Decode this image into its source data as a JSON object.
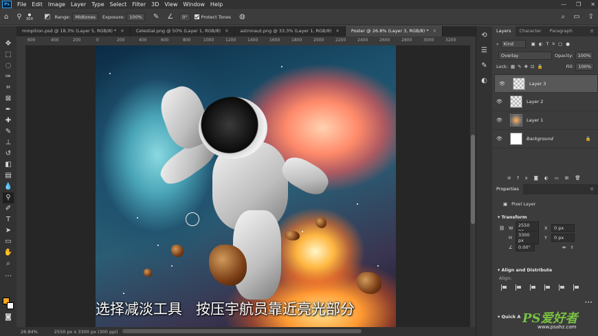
{
  "menubar": {
    "app_icon": "Ps",
    "items": [
      "File",
      "Edit",
      "Image",
      "Layer",
      "Type",
      "Select",
      "Filter",
      "3D",
      "View",
      "Window",
      "Help"
    ]
  },
  "options": {
    "brush_size": "300",
    "range_label": "Range:",
    "range_value": "Midtones",
    "exposure_label": "Exposure:",
    "exposure_value": "100%",
    "angle_value": "0°",
    "protect_tones": "Protect Tones"
  },
  "tabs": [
    {
      "label": "mmpition.psd @ 18.3% (Layer 5, RGB/8) *"
    },
    {
      "label": "Celestial.png @ 50% (Layer 1, RGB/8)"
    },
    {
      "label": "astronaut.png @ 33.3% (Layer 1, RGB/8)"
    },
    {
      "label": "Poster @ 26.8% (Layer 3, RGB/8) *"
    }
  ],
  "ruler": [
    "600",
    "400",
    "200",
    "0",
    "200",
    "400",
    "600",
    "800",
    "1000",
    "1200",
    "1400",
    "1600",
    "1800",
    "2000",
    "2200",
    "2400",
    "2600",
    "2800",
    "3000",
    "3200"
  ],
  "status": {
    "zoom": "26.84%",
    "doc_size": "2550 px x 3300 px (300 ppi)"
  },
  "subtitle": "选择减淡工具   按压宇航员靠近亮光部分",
  "layers_panel": {
    "tabs": [
      "Layers",
      "Character",
      "Paragraph"
    ],
    "kind": "Kind",
    "blend_mode": "Overlay",
    "opacity_label": "Opacity:",
    "opacity": "100%",
    "lock_label": "Lock:",
    "fill_label": "Fill:",
    "fill": "100%",
    "layers": [
      {
        "name": "Layer 3",
        "selected": true
      },
      {
        "name": "Layer 2",
        "selected": false
      },
      {
        "name": "Layer 1",
        "selected": false
      },
      {
        "name": "Background",
        "selected": false
      }
    ]
  },
  "properties": {
    "title": "Properties",
    "type": "Pixel Layer",
    "transform": "Transform",
    "w_label": "W",
    "w": "2550 px",
    "h_label": "H",
    "h": "3300 px",
    "x_label": "X",
    "x": "0 px",
    "y_label": "Y",
    "y": "0 px",
    "angle": "0.00°",
    "align_title": "Align and Distribute",
    "align_label": "Align:",
    "quick_label": "Quick A"
  },
  "watermark": {
    "brand": "PS爱好者",
    "url": "www.psahz.com"
  },
  "colors": {
    "foreground": "#f5a623",
    "background": "#ffffff",
    "accent": "#31a8ff"
  }
}
